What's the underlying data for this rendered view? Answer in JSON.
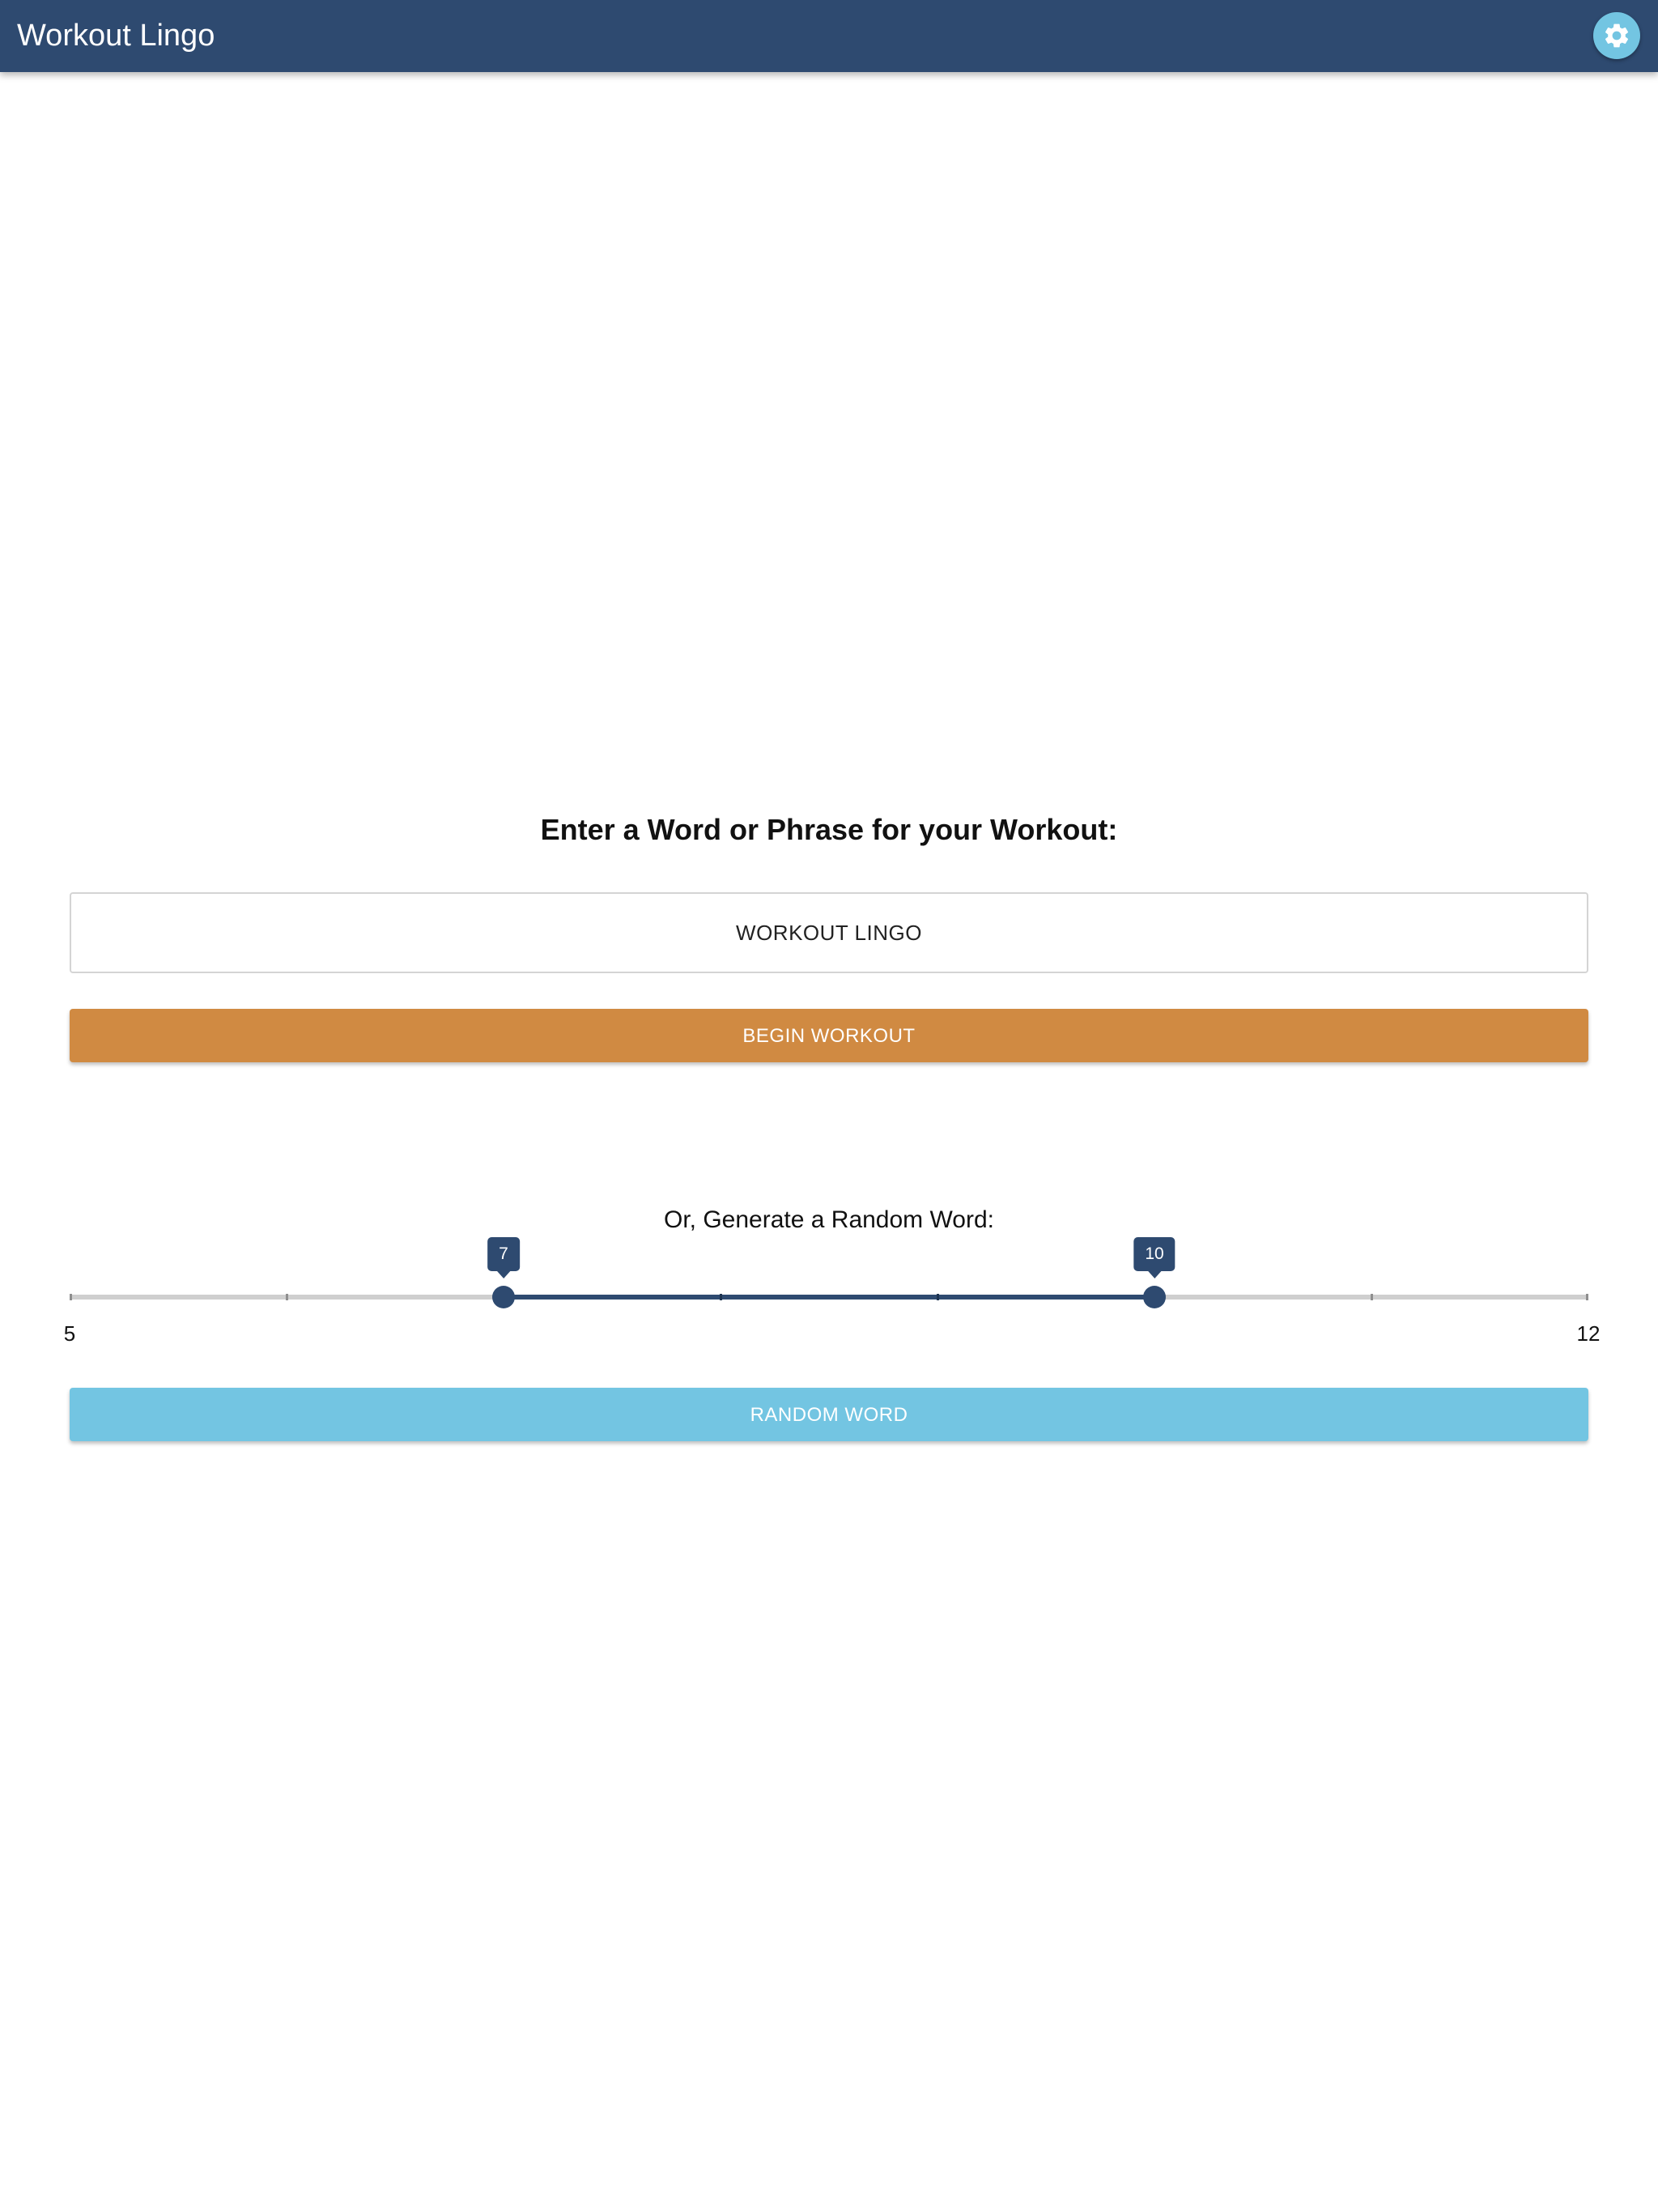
{
  "header": {
    "title": "Workout Lingo",
    "settings_icon": "gear-icon"
  },
  "main": {
    "heading": "Enter a Word or Phrase for your Workout:",
    "phrase_input": {
      "value": "WORKOUT LINGO",
      "placeholder": ""
    },
    "begin_button": "BEGIN WORKOUT",
    "random_heading": "Or, Generate a Random Word:",
    "length_slider": {
      "min": 5,
      "max": 12,
      "min_label": "5",
      "max_label": "12",
      "low": 7,
      "high": 10,
      "low_label": "7",
      "high_label": "10"
    },
    "random_button": "RANDOM WORD"
  },
  "colors": {
    "primary": "#2e4a70",
    "accent": "#73c5e2",
    "begin": "#d08a42"
  }
}
